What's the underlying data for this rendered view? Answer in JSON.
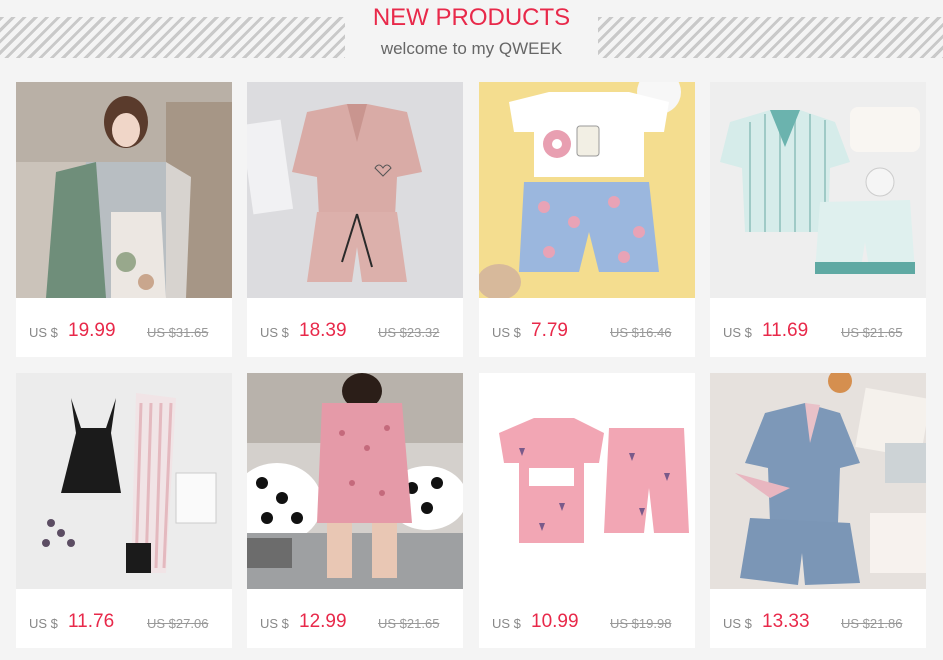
{
  "header": {
    "title": "NEW PRODUCTS",
    "subtitle": "welcome to my QWEEK"
  },
  "colors": {
    "accent": "#e8294a",
    "muted": "#888888"
  },
  "products": [
    {
      "currency": "US $",
      "price": "19.99",
      "old_price": "US $31.65",
      "image": "woman-in-floral-robe-pajamas"
    },
    {
      "currency": "US $",
      "price": "18.39",
      "old_price": "US $23.32",
      "image": "pink-satin-shirt-shorts-set"
    },
    {
      "currency": "US $",
      "price": "7.79",
      "old_price": "US $16.46",
      "image": "white-tee-donut-print-shorts"
    },
    {
      "currency": "US $",
      "price": "11.69",
      "old_price": "US $21.65",
      "image": "striped-shirt-teal-trim-set"
    },
    {
      "currency": "US $",
      "price": "11.76",
      "old_price": "US $27.06",
      "image": "black-cami-striped-pants"
    },
    {
      "currency": "US $",
      "price": "12.99",
      "old_price": "US $21.65",
      "image": "woman-pink-print-pajamas"
    },
    {
      "currency": "US $",
      "price": "10.99",
      "old_price": "US $19.98",
      "image": "pink-ice-cream-print-set"
    },
    {
      "currency": "US $",
      "price": "13.33",
      "old_price": "US $21.86",
      "image": "blue-satin-pink-trim-set"
    }
  ]
}
